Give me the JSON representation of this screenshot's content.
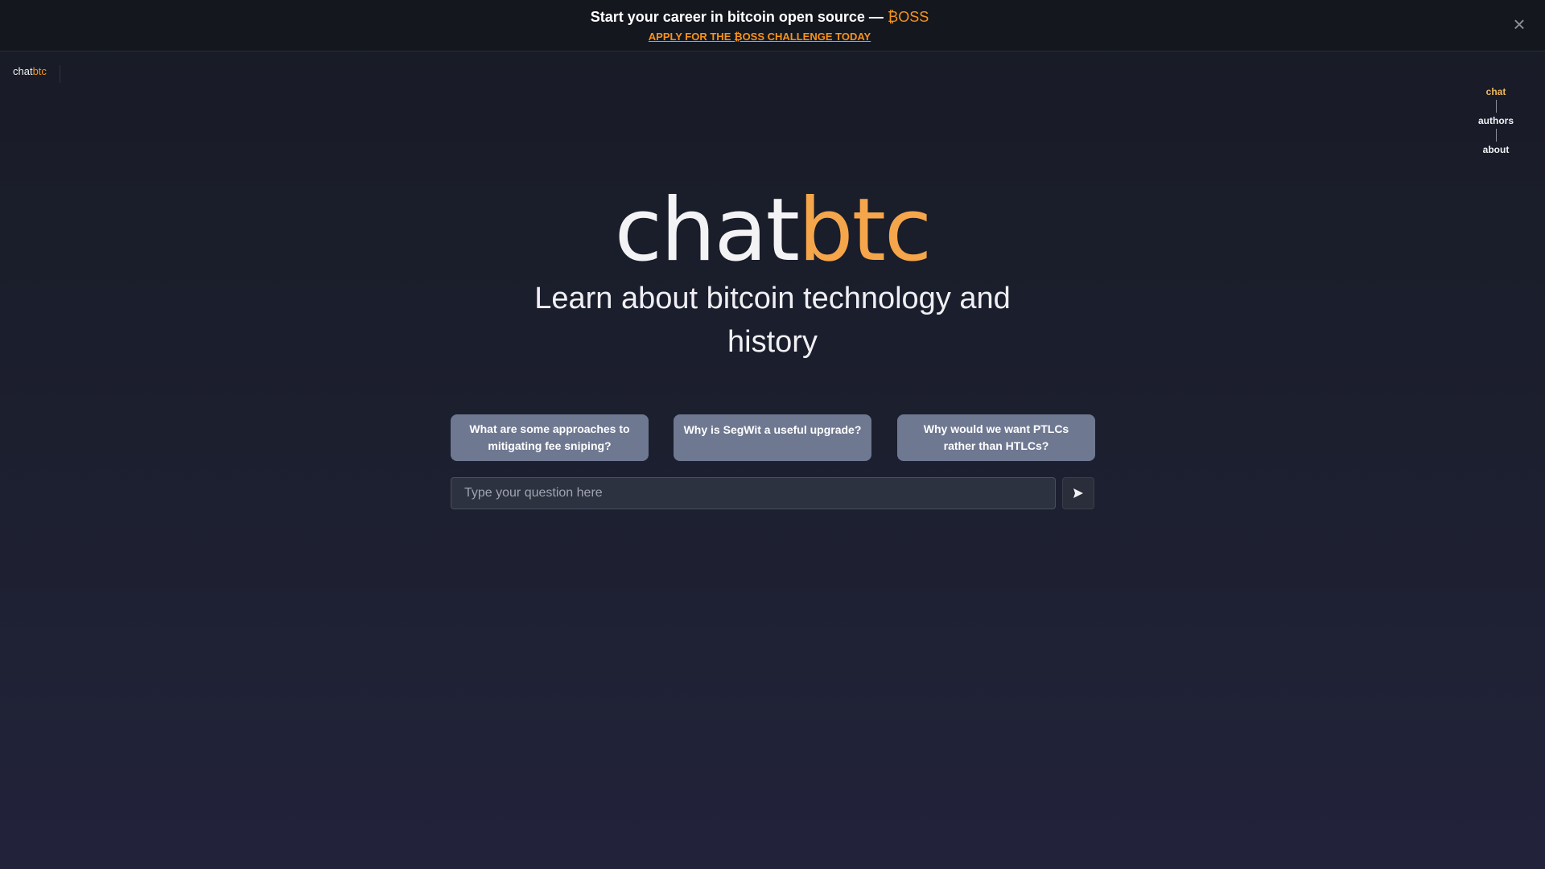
{
  "banner": {
    "title_text": "Start your career in bitcoin open source — ",
    "title_brand": "₿OSS",
    "link_label": "APPLY FOR THE ₿OSS CHALLENGE TODAY",
    "close_icon": "×"
  },
  "header": {
    "logo_main": "chat",
    "logo_accent": "btc"
  },
  "nav": {
    "items": [
      {
        "label": "chat",
        "active": true
      },
      {
        "label": "authors",
        "active": false
      },
      {
        "label": "about",
        "active": false
      }
    ]
  },
  "hero": {
    "title_main": "chat",
    "title_accent": "btc",
    "subtitle": "Learn about bitcoin technology and history"
  },
  "suggestions": [
    "What are some approaches to mitigating fee sniping?",
    "Why is SegWit a useful upgrade?",
    "Why would we want PTLCs rather than HTLCs?"
  ],
  "input": {
    "placeholder": "Type your question here",
    "value": ""
  },
  "colors": {
    "accent": "#f7931a",
    "nav_active": "#f0b85a",
    "suggestion_bg": "#6f7891"
  },
  "icons": {
    "close": "close-icon",
    "send": "send-arrow-icon"
  }
}
